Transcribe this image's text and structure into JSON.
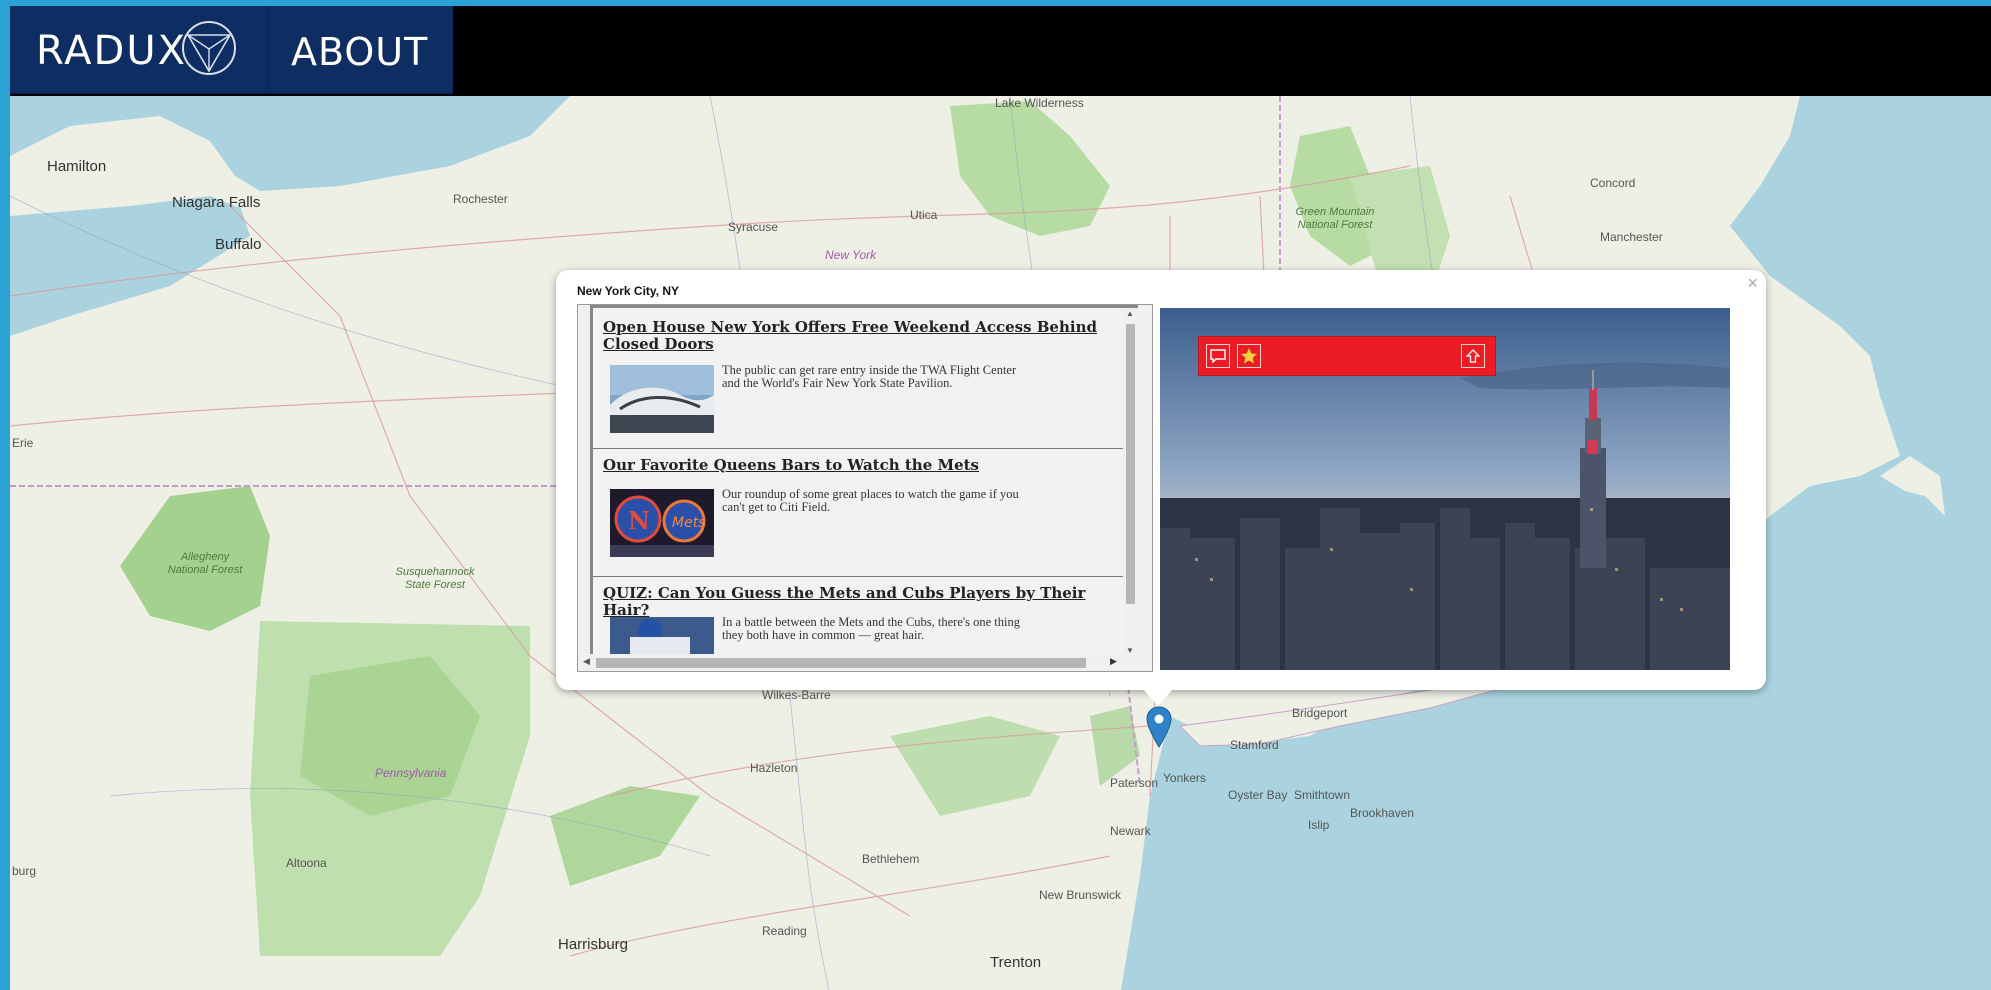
{
  "header": {
    "brand": "RADUX",
    "logo_icon": "triangle-circle-logo-icon",
    "nav_about": "ABOUT"
  },
  "map": {
    "places": {
      "hamilton": "Hamilton",
      "niagara": "Niagara Falls",
      "buffalo": "Buffalo",
      "rochester": "Rochester",
      "syracuse": "Syracuse",
      "utica": "Utica",
      "newyork_state": "New York",
      "concord": "Concord",
      "manchester": "Manchester",
      "green_mountain": "Green Mountain National Forest",
      "lake_wilderness": "Lake Wilderness",
      "allegheny": "Allegheny National Forest",
      "susquehannock": "Susquehannock State Forest",
      "pennsylvania": "Pennsylvania",
      "wilkes_barre": "Wilkes-Barre",
      "hazleton": "Hazleton",
      "altoona": "Altoona",
      "harrisburg": "Harrisburg",
      "reading": "Reading",
      "bethlehem": "Bethlehem",
      "trenton": "Trenton",
      "new_brunswick": "New Brunswick",
      "newark": "Newark",
      "paterson": "Paterson",
      "yonkers": "Yonkers",
      "stamford": "Stamford",
      "bridgeport": "Bridgeport",
      "oyster_bay": "Oyster Bay",
      "smithtown": "Smithtown",
      "brookhaven": "Brookhaven",
      "islip": "Islip",
      "erie": "Erie",
      "burg": "burg"
    },
    "marker_icon": "map-pin-icon"
  },
  "popup": {
    "title": "New York City, NY",
    "close_glyph": "×",
    "articles": [
      {
        "headline": "Open House New York Offers Free Weekend Access Behind Closed Doors",
        "summary": "The public can get rare entry inside the TWA Flight Center and the World's Fair New York State Pavilion."
      },
      {
        "headline": "Our Favorite Queens Bars to Watch the Mets",
        "summary": "Our roundup of some great places to watch the game if you can't get to Citi Field."
      },
      {
        "headline": "QUIZ: Can You Guess the Mets and Cubs Players by Their Hair?",
        "summary": "In a battle between the Mets and the Cubs, there's one thing they both have in common — great hair."
      }
    ],
    "toolbar": {
      "color": "#ec1c24",
      "comment_icon": "comment-icon",
      "favorite_icon": "star-icon",
      "share_icon": "share-up-arrow-icon"
    }
  }
}
